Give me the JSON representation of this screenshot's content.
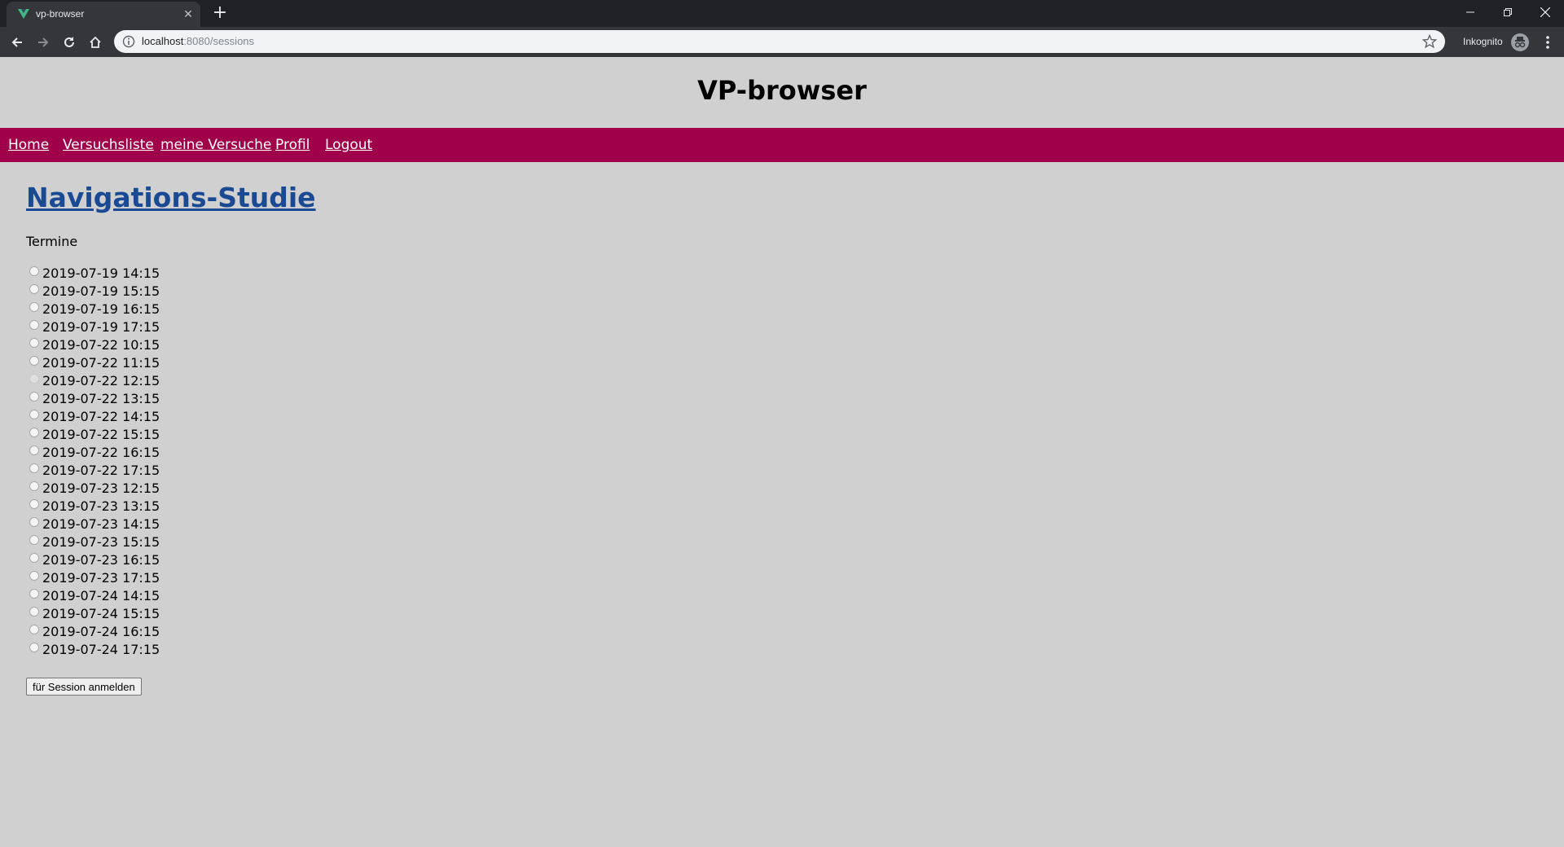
{
  "browser": {
    "tab_title": "vp-browser",
    "address_host": "localhost",
    "address_path": ":8080/sessions",
    "incognito_label": "Inkognito"
  },
  "site": {
    "title": "VP-browser",
    "nav": [
      "Home",
      "Versuchsliste",
      "meine Versuche",
      "Profil",
      "Logout"
    ]
  },
  "study": {
    "title": "Navigations-Studie",
    "termine_label": "Termine",
    "slots": [
      "2019-07-19 14:15",
      "2019-07-19 15:15",
      "2019-07-19 16:15",
      "2019-07-19 17:15",
      "2019-07-22 10:15",
      "2019-07-22 11:15",
      "2019-07-22 12:15",
      "2019-07-22 13:15",
      "2019-07-22 14:15",
      "2019-07-22 15:15",
      "2019-07-22 16:15",
      "2019-07-22 17:15",
      "2019-07-23 12:15",
      "2019-07-23 13:15",
      "2019-07-23 14:15",
      "2019-07-23 15:15",
      "2019-07-23 16:15",
      "2019-07-23 17:15",
      "2019-07-24 14:15",
      "2019-07-24 15:15",
      "2019-07-24 16:15",
      "2019-07-24 17:15"
    ],
    "submit_label": "für Session anmelden"
  }
}
